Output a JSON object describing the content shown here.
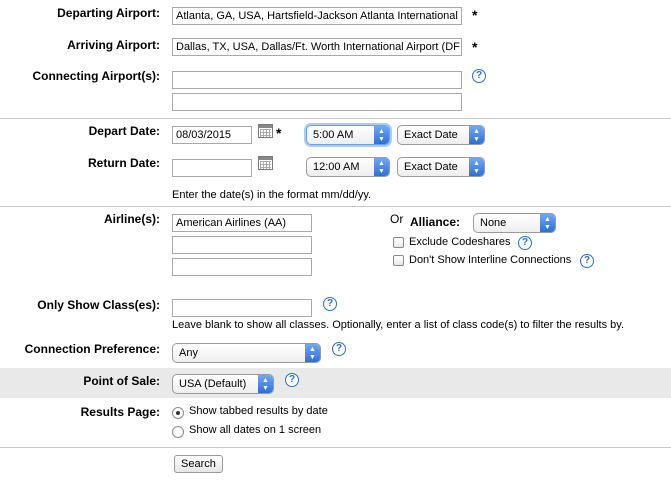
{
  "departing": {
    "label": "Departing Airport:",
    "value": "Atlanta, GA, USA, Hartsfield-Jackson Atlanta International"
  },
  "arriving": {
    "label": "Arriving Airport:",
    "value": "Dallas, TX, USA, Dallas/Ft. Worth International Airport (DF"
  },
  "connecting": {
    "label": "Connecting Airport(s):",
    "value1": "",
    "value2": ""
  },
  "required_mark": "*",
  "help_glyph": "?",
  "depart": {
    "label": "Depart Date:",
    "date": "08/03/2015",
    "time": "5:00 AM",
    "flex": "Exact Date"
  },
  "return": {
    "label": "Return Date:",
    "date": "",
    "time": "12:00 AM",
    "flex": "Exact Date"
  },
  "date_hint": "Enter the date(s) in the format mm/dd/yy.",
  "airlines": {
    "label": "Airline(s):",
    "value1": "American Airlines (AA)",
    "value2": "",
    "value3": ""
  },
  "alliance": {
    "or_text": "Or",
    "label": "Alliance:",
    "value": "None"
  },
  "exclude_codeshares": {
    "label": "Exclude Codeshares",
    "checked": false
  },
  "no_interline": {
    "label": "Don't Show Interline Connections",
    "checked": false
  },
  "classes": {
    "label": "Only Show Class(es):",
    "value": "",
    "hint": "Leave blank to show all classes. Optionally, enter a list of class code(s) to filter the results by."
  },
  "connection_pref": {
    "label": "Connection Preference:",
    "value": "Any"
  },
  "point_of_sale": {
    "label": "Point of Sale:",
    "value": "USA (Default)"
  },
  "results_page": {
    "label": "Results Page:",
    "option1": "Show tabbed results by date",
    "option2": "Show all dates on 1 screen",
    "selected": 1
  },
  "search_button": "Search",
  "colors": {
    "help": "#2a6fc9",
    "select_arrow": "#2d6fd6",
    "band": "#e9e9e9"
  }
}
